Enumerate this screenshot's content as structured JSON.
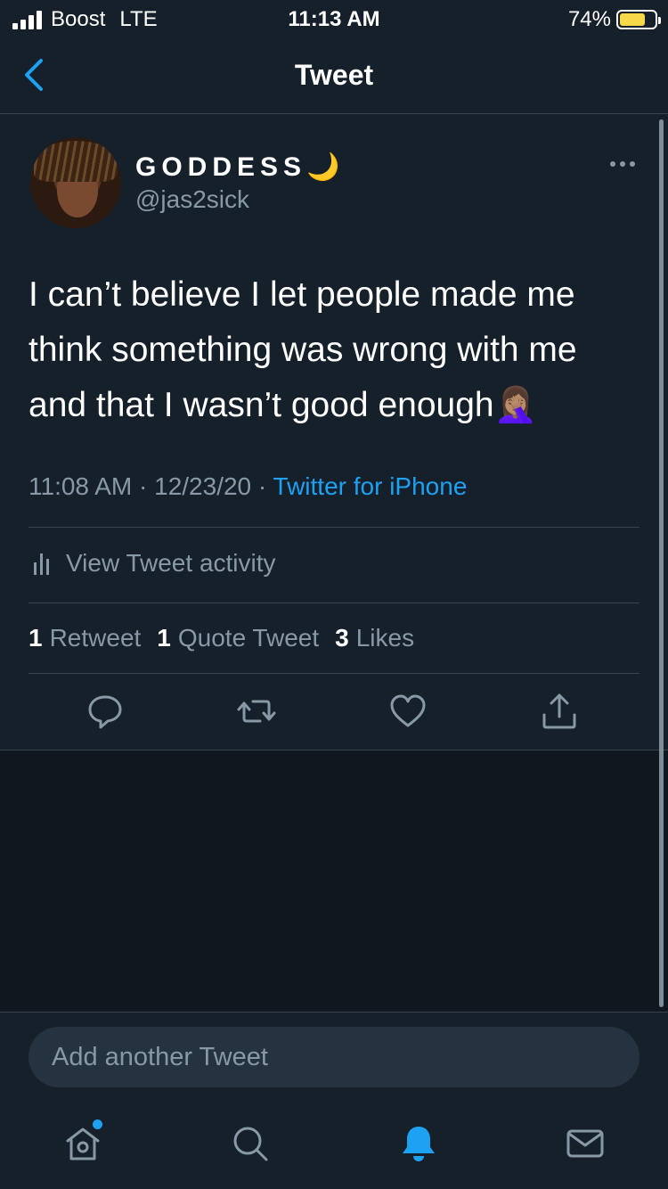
{
  "status_bar": {
    "carrier": "Boost",
    "network": "LTE",
    "time": "11:13 AM",
    "battery": "74%",
    "battery_level": 0.74
  },
  "nav": {
    "title": "Tweet",
    "back_icon": "chevron-left-icon"
  },
  "tweet": {
    "display_name": "GODDESS🌙",
    "handle": "@jas2sick",
    "text": "I can’t believe I let people made me think something was wrong with me and that I wasn’t good enough🤦🏽‍♀️",
    "time": "11:08 AM",
    "date": "12/23/20",
    "separator": "·",
    "source": "Twitter for iPhone",
    "activity_label": "View Tweet activity",
    "stats": {
      "retweets_count": "1",
      "retweets_label": "Retweet",
      "quotes_count": "1",
      "quotes_label": "Quote Tweet",
      "likes_count": "3",
      "likes_label": "Likes"
    }
  },
  "compose": {
    "placeholder": "Add another Tweet"
  },
  "tabbar": {
    "items": [
      "home-icon",
      "search-icon",
      "notifications-icon",
      "messages-icon"
    ],
    "active": "notifications-icon"
  },
  "colors": {
    "background": "#15202b",
    "accent": "#1da1f2",
    "secondary_text": "#8899a6",
    "divider": "#38444d"
  }
}
